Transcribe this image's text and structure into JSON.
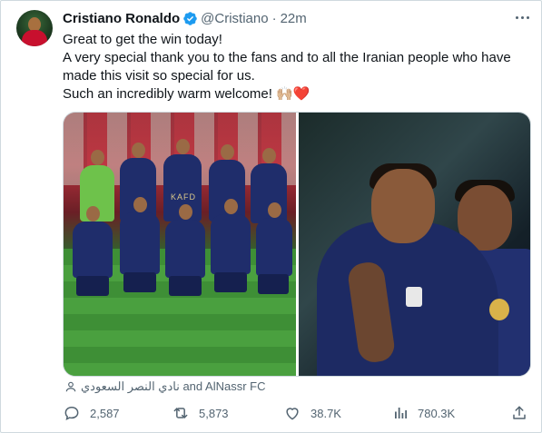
{
  "tweet": {
    "author_name": "Cristiano Ronaldo",
    "handle": "@Cristiano",
    "separator": "·",
    "time": "22m",
    "lines": [
      "Great to get the win today!",
      "A very special thank you to the fans and to all the Iranian people who have",
      "made this visit so special for us.",
      "Such an incredibly warm welcome! 🙌🏼❤️"
    ],
    "tagged": "نادي النصر السعودي and AlNassr FC",
    "jersey_text": "KAFD"
  },
  "actions": {
    "replies": "2,587",
    "reposts": "5,873",
    "likes": "38.7K",
    "views": "780.3K"
  },
  "colors": {
    "verified": "#1d9bf0",
    "text": "#0f1419",
    "muted": "#536471",
    "heart": "#f91880"
  },
  "icons": [
    "verified-icon",
    "more-icon",
    "person-icon",
    "reply-icon",
    "repost-icon",
    "like-icon",
    "views-icon",
    "share-icon"
  ]
}
